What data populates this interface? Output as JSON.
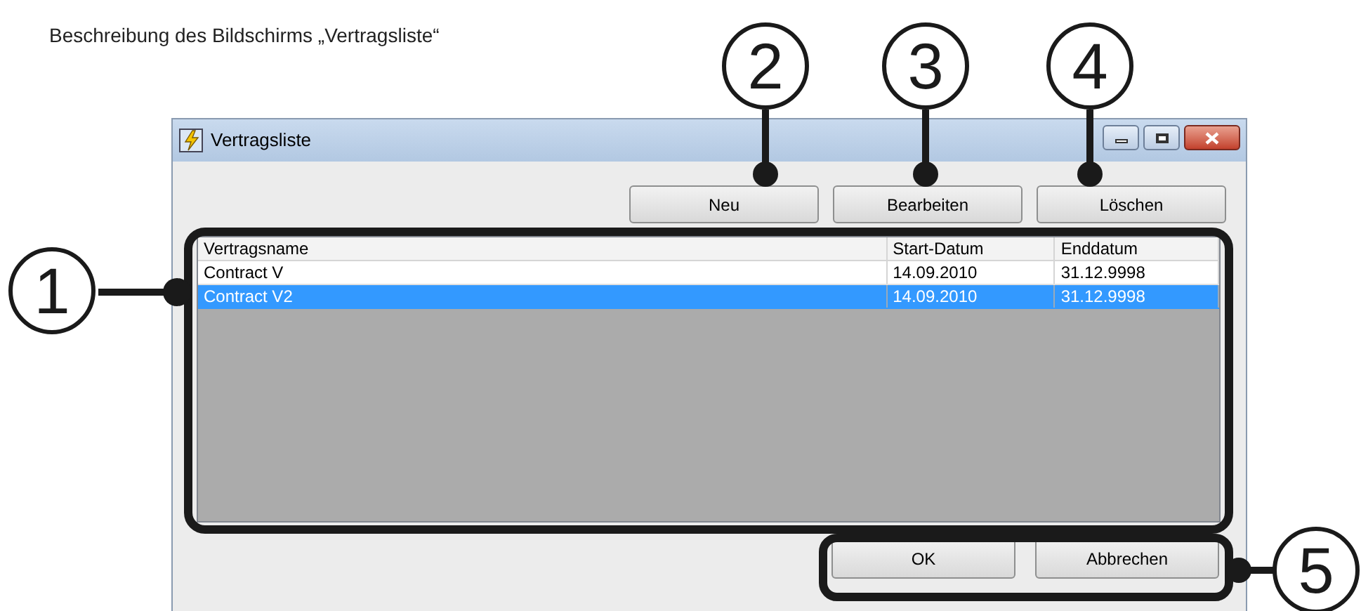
{
  "caption": "Beschreibung des Bildschirms „Vertragsliste“",
  "window": {
    "title": "Vertragsliste"
  },
  "toolbar_buttons": [
    "Neu",
    "Bearbeiten",
    "Löschen"
  ],
  "table": {
    "columns": [
      "Vertragsname",
      "Start-Datum",
      "Enddatum"
    ],
    "rows": [
      {
        "cells": [
          "Contract V",
          "14.09.2010",
          "31.12.9998"
        ],
        "selected": false
      },
      {
        "cells": [
          "Contract V2",
          "14.09.2010",
          "31.12.9998"
        ],
        "selected": true
      }
    ]
  },
  "dialog_buttons": [
    "OK",
    "Abbrechen"
  ],
  "callouts": [
    "1",
    "2",
    "3",
    "4",
    "5"
  ]
}
